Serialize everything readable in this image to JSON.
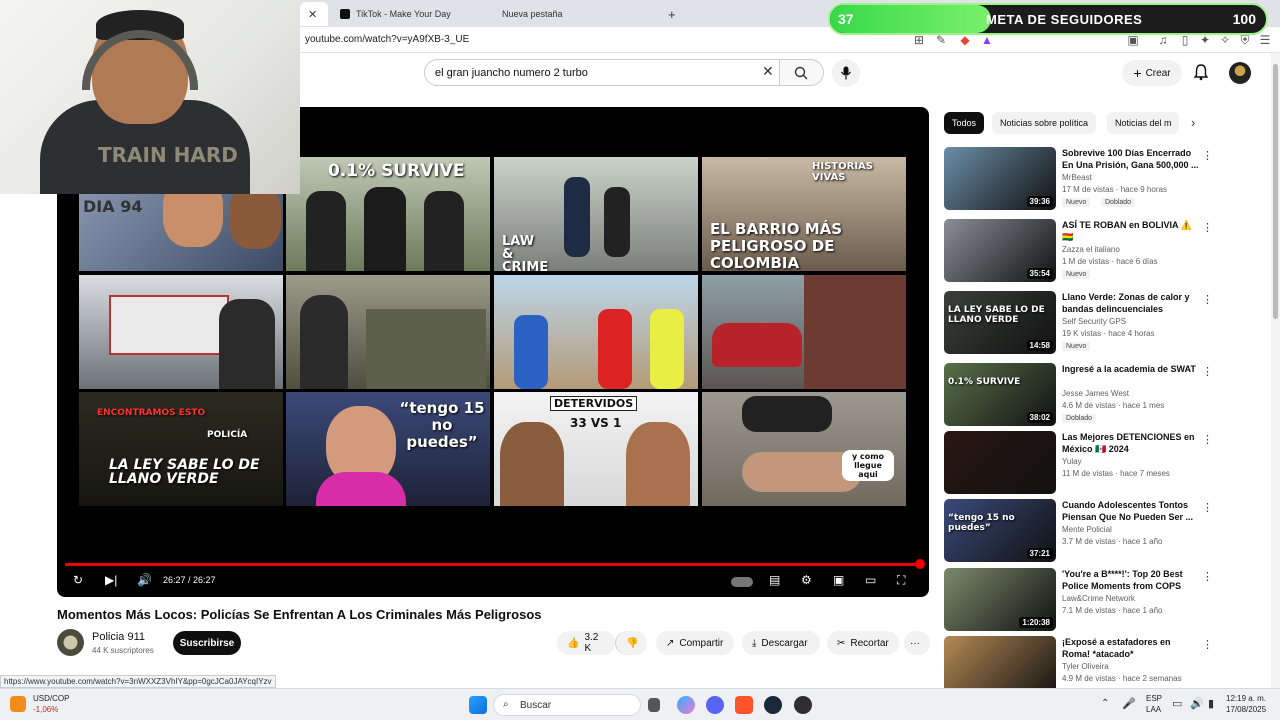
{
  "browser": {
    "tabs": [
      {
        "label": "TikTok - Make Your Day"
      },
      {
        "label": "Nueva pestaña"
      }
    ],
    "new_tab": "+",
    "url": "youtube.com/watch?v=yA9fXB-3_UE",
    "status_link": "https://www.youtube.com/watch?v=3nWXXZ3VhIY&pp=0gcJCa0JAYcqIYzv"
  },
  "overlay": {
    "goal_count": "37",
    "goal_label": "META DE SEGUIDORES",
    "goal_target": "100",
    "goal_progress": 0.37,
    "colors": {
      "fill": "#38d94a",
      "border": "#9df28a"
    },
    "shirt_text": "TRAIN HARD"
  },
  "youtube": {
    "search_query": "el gran juancho numero 2 turbo",
    "create_label": "Crear",
    "icons": [
      "search-icon",
      "mic-icon",
      "bell-icon",
      "plus-icon"
    ]
  },
  "player": {
    "time": "26:27 / 26:27",
    "progress": 1.0,
    "thumb_captions": {
      "survive": "0.1% SURVIVE",
      "historias": "HISTORIAS VIVAS",
      "barrio": "EL BARRIO MÁS PELIGROSO DE COLOMBIA",
      "law": "LAW & CRIME",
      "ley": "LA LEY SABE LO DE LLANO VERDE",
      "tengo": "“tengo 15 no puedes”",
      "detervidos": "DETERVIDOS",
      "vs": "33 VS 1",
      "policia": "POLICÍA",
      "llegue": "y como llegue aqui",
      "encontramos": "ENCONTRAMOS ESTO",
      "dia": "DIA 94"
    },
    "accent": "#ee0000"
  },
  "video": {
    "title": "Momentos Más Locos: Policías Se Enfrentan A Los Criminales Más Peligrosos",
    "channel": "Policia 911",
    "subscribers": "44 K suscriptores",
    "subscribe_label": "Suscribirse",
    "likes": "3.2 K",
    "share_label": "Compartir",
    "download_label": "Descargar",
    "clip_label": "Recortar",
    "more_label": "···"
  },
  "sidebar": {
    "chips": [
      "Todos",
      "Noticias sobre política",
      "Noticias del m"
    ],
    "recommendations": [
      {
        "title": "Sobrevive 100 Días Encerrado En Una Prisión, Gana 500,000 ...",
        "channel": "MrBeast",
        "meta": "17 M de vistas · hace 9 horas",
        "duration": "39:36",
        "badges": [
          "Nuevo",
          "Doblado"
        ],
        "thumb_color": "#6b8ea8"
      },
      {
        "title": "ASÍ TE ROBAN en BOLIVIA ⚠️ 🇧🇴",
        "channel": "Zazza el italiano",
        "meta": "1 M de vistas · hace 6 días",
        "duration": "35:54",
        "badges": [
          "Nuevo"
        ],
        "thumb_color": "#8a8f96"
      },
      {
        "title": "Llano Verde: Zonas de calor y bandas delincuenciales",
        "channel": "Self Security GPS",
        "meta": "19 K vistas · hace 4 horas",
        "duration": "14:58",
        "badges": [
          "Nuevo"
        ],
        "thumb_color": "#3b3f3c",
        "caption": "LA LEY SABE LO DE LLANO VERDE"
      },
      {
        "title": "Ingresé a la academia de SWAT",
        "channel": "Jesse James West",
        "meta": "4.6 M de vistas · hace 1 mes",
        "duration": "38:02",
        "badges": [
          "Doblado"
        ],
        "thumb_color": "#59704a",
        "caption": "0.1% SURVIVE"
      },
      {
        "title": "Las Mejores DETENCIONES en México 🇲🇽 2024",
        "channel": "Yulay",
        "meta": "11 M de vistas · hace 7 meses",
        "duration": "",
        "badges": [],
        "thumb_color": "#2a1712"
      },
      {
        "title": "Cuando Adolescentes Tontos Piensan Que No Pueden Ser ...",
        "channel": "Mente Policial",
        "meta": "3.7 M de vistas · hace 1 año",
        "duration": "37:21",
        "badges": [],
        "thumb_color": "#3a4a7a",
        "caption": "“tengo 15 no puedes”"
      },
      {
        "title": "'You're a B****!': Top 20 Best Police Moments from COPS",
        "channel": "Law&Crime Network",
        "meta": "7.1 M de vistas · hace 1 año",
        "duration": "1:20:38",
        "badges": [],
        "thumb_color": "#7b8a6c"
      },
      {
        "title": "¡Exposé a estafadores en Roma! *atacado*",
        "channel": "Tyler Oliveira",
        "meta": "4.9 M de vistas · hace 2 semanas",
        "duration": "",
        "badges": [],
        "thumb_color": "#b58a55"
      }
    ]
  },
  "taskbar": {
    "ticker": "USD/COP",
    "ticker_change": "-1,06%",
    "search_label": "Buscar",
    "lang": "ESP",
    "lang2": "LAA",
    "time": "12:19 a. m.",
    "date": "17/08/2025"
  }
}
